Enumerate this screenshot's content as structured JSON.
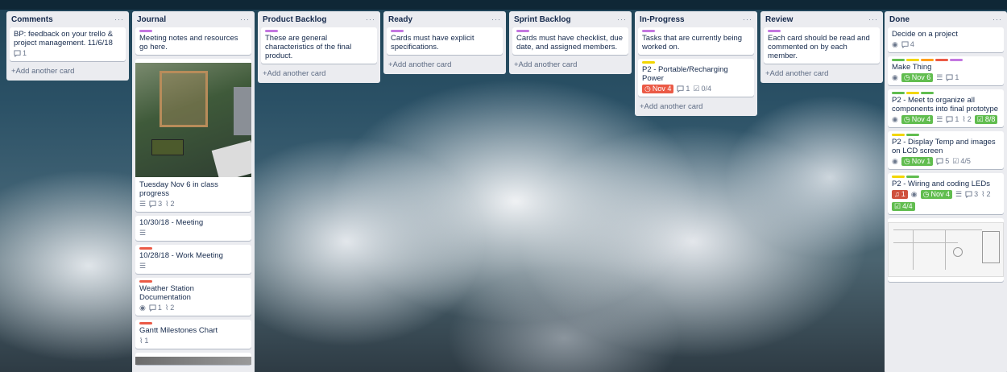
{
  "colors": {
    "purple": "#c377e0",
    "green": "#61bd4f",
    "yellow": "#f2d600",
    "red": "#eb5a46",
    "orange": "#ff9f1a",
    "blue": "#0079bf"
  },
  "lists": [
    {
      "title": "Comments",
      "cards": [
        {
          "title": "BP: feedback on your trello & project management. 11/6/18",
          "comments": "1"
        }
      ],
      "add": "+Add another card"
    },
    {
      "title": "Journal",
      "cards": [
        {
          "title": "Meeting notes and resources go here."
        },
        {
          "title": "Tuesday Nov 6 in class progress",
          "comments": "3",
          "attachments": "2"
        },
        {
          "title": "10/30/18 - Meeting"
        },
        {
          "title": "10/28/18 - Work Meeting"
        },
        {
          "title": "Weather Station Documentation",
          "comments": "1",
          "attachments": "2"
        },
        {
          "title": "Gantt Milestones Chart",
          "attachments": "1"
        }
      ]
    },
    {
      "title": "Product Backlog",
      "cards": [
        {
          "title": "These are general characteristics of the final product."
        }
      ],
      "add": "+Add another card"
    },
    {
      "title": "Ready",
      "cards": [
        {
          "title": "Cards must have explicit specifications."
        }
      ],
      "add": "+Add another card"
    },
    {
      "title": "Sprint Backlog",
      "cards": [
        {
          "title": "Cards must have checklist, due date, and assigned members."
        }
      ],
      "add": "+Add another card"
    },
    {
      "title": "In-Progress",
      "cards": [
        {
          "title": "Tasks that are currently being worked on."
        },
        {
          "title": "P2 - Portable/Recharging Power",
          "due": "Nov 4",
          "comments": "1",
          "checklist": "0/4"
        }
      ],
      "add": "+Add another card"
    },
    {
      "title": "Review",
      "cards": [
        {
          "title": "Each card should be read and commented on by each member."
        }
      ],
      "add": "+Add another card"
    },
    {
      "title": "Done",
      "cards": [
        {
          "title": "Decide on a project",
          "comments": "4"
        },
        {
          "title": "Make Thing",
          "due": "Nov 6",
          "comments": "1"
        },
        {
          "title": "P2 - Meet to organize all components into final prototype",
          "due": "Nov 4",
          "comments": "1",
          "attachments": "2",
          "checklist": "8/8"
        },
        {
          "title": "P2 - Display Temp and images on LCD screen",
          "due": "Nov 1",
          "comments": "5",
          "checklist": "4/5"
        },
        {
          "title": "P2 - Wiring and coding LEDs",
          "alerts": "1",
          "due": "Nov 4",
          "comments": "3",
          "attachments": "2",
          "checklist": "4/4"
        }
      ]
    }
  ]
}
